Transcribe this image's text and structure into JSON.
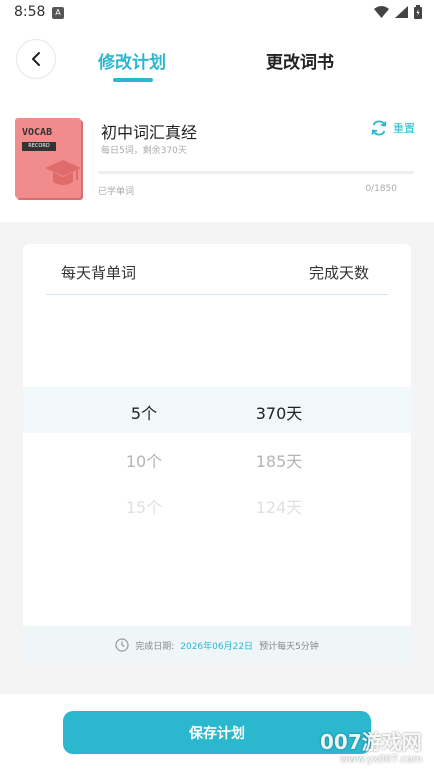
{
  "status_bar": {
    "time": "8:58"
  },
  "header": {
    "tabs": [
      {
        "label": "修改计划"
      },
      {
        "label": "更改词书"
      }
    ]
  },
  "book": {
    "cover_title": "VOCAB",
    "cover_tag": "RECORD",
    "title": "初中词汇真经",
    "subtitle": "每日5词，剩余370天",
    "reset_label": "重置",
    "progress_label": "已学单词",
    "progress_count": "0/1850",
    "progress_fraction": 0
  },
  "plan": {
    "header_left": "每天背单词",
    "header_right": "完成天数",
    "words_per_day": [
      "5个",
      "10个",
      "15个"
    ],
    "days": [
      "370天",
      "185天",
      "124天"
    ],
    "finish_label": "完成日期:",
    "finish_date": "2026年06月22日",
    "estimate": "预计每天5分钟"
  },
  "save_label": "保存计划",
  "watermark": {
    "main": "007游戏网",
    "url": "www.yx007.com"
  },
  "colors": {
    "accent": "#2bb8cf",
    "cover": "#f28b8b"
  }
}
